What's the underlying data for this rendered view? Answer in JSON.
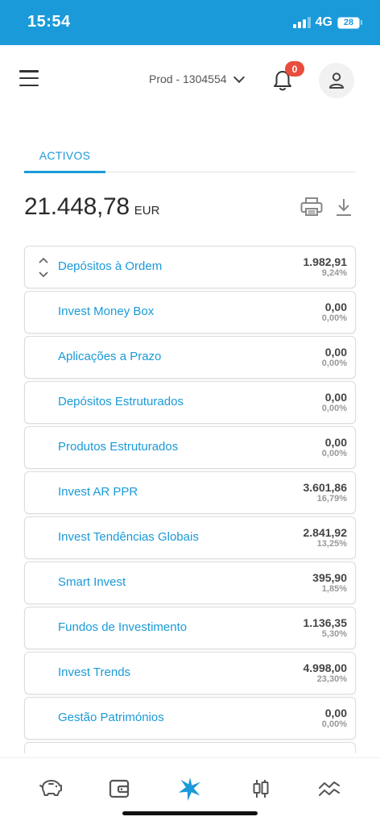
{
  "status_bar": {
    "time": "15:54",
    "network": "4G",
    "battery": "28"
  },
  "header": {
    "account": "Prod - 1304554",
    "notification_count": "0"
  },
  "tabs": [
    {
      "label": "ACTIVOS"
    }
  ],
  "summary": {
    "total": "21.448,78",
    "currency": "EUR"
  },
  "portfolio": [
    {
      "label": "Depósitos à Ordem",
      "amount": "1.982,91",
      "percent": "9,24%"
    },
    {
      "label": "Invest Money Box",
      "amount": "0,00",
      "percent": "0,00%"
    },
    {
      "label": "Aplicações a Prazo",
      "amount": "0,00",
      "percent": "0,00%"
    },
    {
      "label": "Depósitos Estruturados",
      "amount": "0,00",
      "percent": "0,00%"
    },
    {
      "label": "Produtos Estruturados",
      "amount": "0,00",
      "percent": "0,00%"
    },
    {
      "label": "Invest AR PPR",
      "amount": "3.601,86",
      "percent": "16,79%"
    },
    {
      "label": "Invest Tendências Globais",
      "amount": "2.841,92",
      "percent": "13,25%"
    },
    {
      "label": "Smart Invest",
      "amount": "395,90",
      "percent": "1,85%"
    },
    {
      "label": "Fundos de Investimento",
      "amount": "1.136,35",
      "percent": "5,30%"
    },
    {
      "label": "Invest Trends",
      "amount": "4.998,00",
      "percent": "23,30%"
    },
    {
      "label": "Gestão Patrimónios",
      "amount": "0,00",
      "percent": "0,00%"
    }
  ],
  "colors": {
    "accent": "#1a9ad9",
    "badge": "#e84c3d",
    "text": "#2b2b2b"
  },
  "bottom_nav": [
    {
      "icon": "piggy-bank-icon"
    },
    {
      "icon": "wallet-icon"
    },
    {
      "icon": "star-logo-icon",
      "active": true
    },
    {
      "icon": "candlestick-icon"
    },
    {
      "icon": "trend-lines-icon"
    }
  ]
}
